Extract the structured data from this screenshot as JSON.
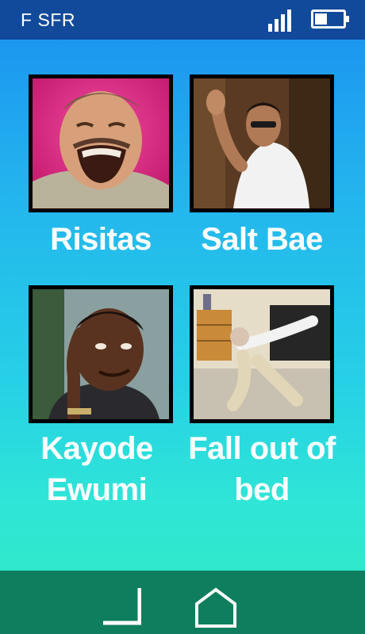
{
  "status": {
    "carrier": "F SFR",
    "signal_icon": "signal-icon",
    "battery_icon": "battery-icon",
    "battery_level": 0.45
  },
  "grid": {
    "items": [
      {
        "caption": "Risitas",
        "image_icon": "laughing-man-image"
      },
      {
        "caption": "Salt Bae",
        "image_icon": "salt-sprinkling-man-image"
      },
      {
        "caption": "Kayode Ewumi",
        "image_icon": "finger-to-temple-man-image"
      },
      {
        "caption": "Fall out of bed",
        "image_icon": "woman-falling-out-of-bed-image"
      }
    ]
  },
  "nav": {
    "back_icon": "back-icon",
    "home_icon": "home-icon"
  },
  "colors": {
    "status_bar": "#114a9a",
    "nav_bar": "#0e7e5e",
    "caption_text": "#ffffff"
  }
}
